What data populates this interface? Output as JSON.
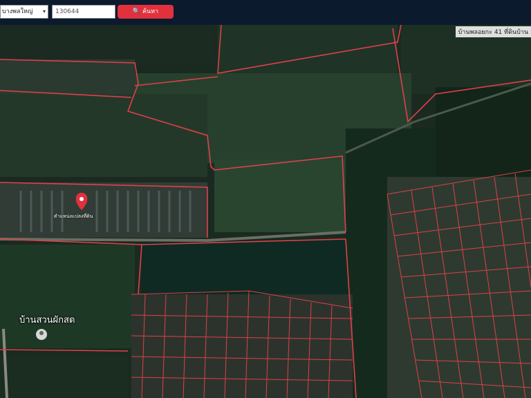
{
  "search": {
    "province_select": "บางพลใหญ่",
    "parcel_input_value": "130644",
    "button_label": "ค้นหา"
  },
  "map": {
    "corner_label": "บ้านพลอยกะ 41 ที่ดินบ้าน",
    "marker_label": "ตำแหน่งแปลงที่ดิน",
    "place_name": "บ้านสวนผักสด",
    "colors": {
      "parcel_border": "#e0404a",
      "marker": "#e0313d",
      "topbar": "#0c1a2e",
      "search_button": "#e0313d"
    }
  }
}
